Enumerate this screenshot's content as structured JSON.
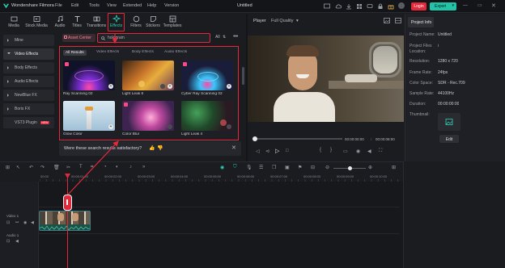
{
  "app": {
    "title": "Wondershare Filmora",
    "menu": [
      "File",
      "Edit",
      "Tools",
      "View",
      "Extended",
      "Help",
      "Version"
    ],
    "project_title": "Untitled",
    "login_label": "Login",
    "export_label": "Export",
    "accent": "#e0293a",
    "export_color": "#1fc5a6"
  },
  "toolbar": {
    "tools": [
      {
        "label": "Media",
        "icon": "media-icon"
      },
      {
        "label": "Stock Media",
        "icon": "stock-media-icon"
      },
      {
        "label": "Audio",
        "icon": "audio-icon"
      },
      {
        "label": "Titles",
        "icon": "titles-icon"
      },
      {
        "label": "Transitions",
        "icon": "transitions-icon"
      },
      {
        "label": "Effects",
        "icon": "effects-icon"
      },
      {
        "label": "Filters",
        "icon": "filters-icon"
      },
      {
        "label": "Stickers",
        "icon": "stickers-icon"
      },
      {
        "label": "Templates",
        "icon": "templates-icon"
      }
    ]
  },
  "left_panel": {
    "items": [
      {
        "label": "Mine"
      },
      {
        "label": "Video Effects"
      },
      {
        "label": "Body Effects"
      },
      {
        "label": "Audio Effects"
      },
      {
        "label": "NewBlue FX"
      },
      {
        "label": "Boris FX"
      },
      {
        "label": "VST3 Plugin"
      }
    ],
    "badge": "NEW"
  },
  "search": {
    "asset_center_label": "Asset Center",
    "query": "hologram",
    "filter_label": "All"
  },
  "results": {
    "tabs": [
      "All Results",
      "Video Effects",
      "Body Effects",
      "Audio Effects"
    ],
    "items": [
      {
        "label": "Ray Scanning 02"
      },
      {
        "label": "Light Leak 6"
      },
      {
        "label": "Cyber Ray Scanning 02"
      },
      {
        "label": "Glow Color"
      },
      {
        "label": "Color Blur"
      },
      {
        "label": "Light Leak 4"
      }
    ],
    "feedback_question": "Were these search results satisfactory?"
  },
  "player": {
    "label": "Player",
    "quality": "Full Quality",
    "time_current": "00:00:00:00",
    "time_total": "00:00:08:00"
  },
  "project_info": {
    "tab_label": "Project Info",
    "rows": [
      {
        "key": "Project Name:",
        "value": "Untitled"
      },
      {
        "key": "Project Files Location:",
        "value": "/"
      },
      {
        "key": "Resolution:",
        "value": "1280 x 720"
      },
      {
        "key": "Frame Rate:",
        "value": "24fps"
      },
      {
        "key": "Color Space:",
        "value": "SDR - Rec.709"
      },
      {
        "key": "Sample Rate:",
        "value": "44100Hz"
      },
      {
        "key": "Duration:",
        "value": "00:00:00:00"
      },
      {
        "key": "Thumbnail:",
        "value": ""
      }
    ],
    "edit_label": "Edit"
  },
  "timeline": {
    "ruler_marks": [
      "00:00",
      "00:00:01:00",
      "00:00:02:00",
      "00:00:03:00",
      "00:00:04:00",
      "00:00:05:00",
      "00:00:06:00",
      "00:00:07:00",
      "00:00:08:00",
      "00:00:09:00",
      "00:00:10:00",
      "00:00:11:00"
    ],
    "video_track_label": "Video 1",
    "audio_track_label": "Audio 1"
  }
}
